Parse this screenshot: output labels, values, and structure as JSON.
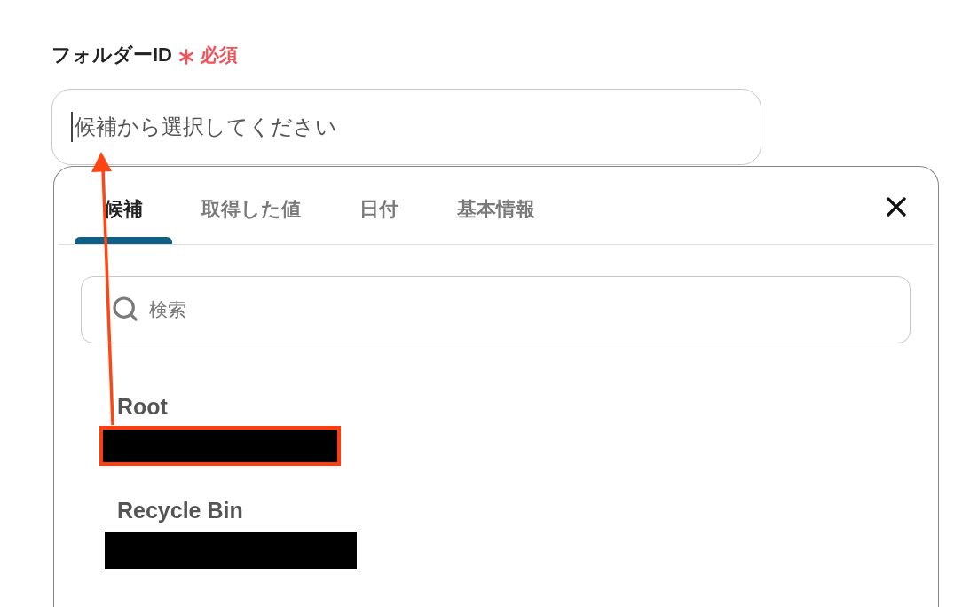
{
  "field": {
    "label": "フォルダーID",
    "required": true,
    "required_text": "必須",
    "placeholder": "候補から選択してください",
    "focused": true
  },
  "panel": {
    "tabs": [
      {
        "label": "候補",
        "selected": true
      },
      {
        "label": "取得した値",
        "selected": false
      },
      {
        "label": "日付",
        "selected": false
      },
      {
        "label": "基本情報",
        "selected": false
      }
    ],
    "search": {
      "placeholder": "検索"
    },
    "items": [
      {
        "name": "Root",
        "id_redacted": true,
        "highlighted": true
      },
      {
        "name": "Recycle Bin",
        "id_redacted": true,
        "highlighted": false
      }
    ]
  },
  "annotation": {
    "kind": "arrow"
  }
}
